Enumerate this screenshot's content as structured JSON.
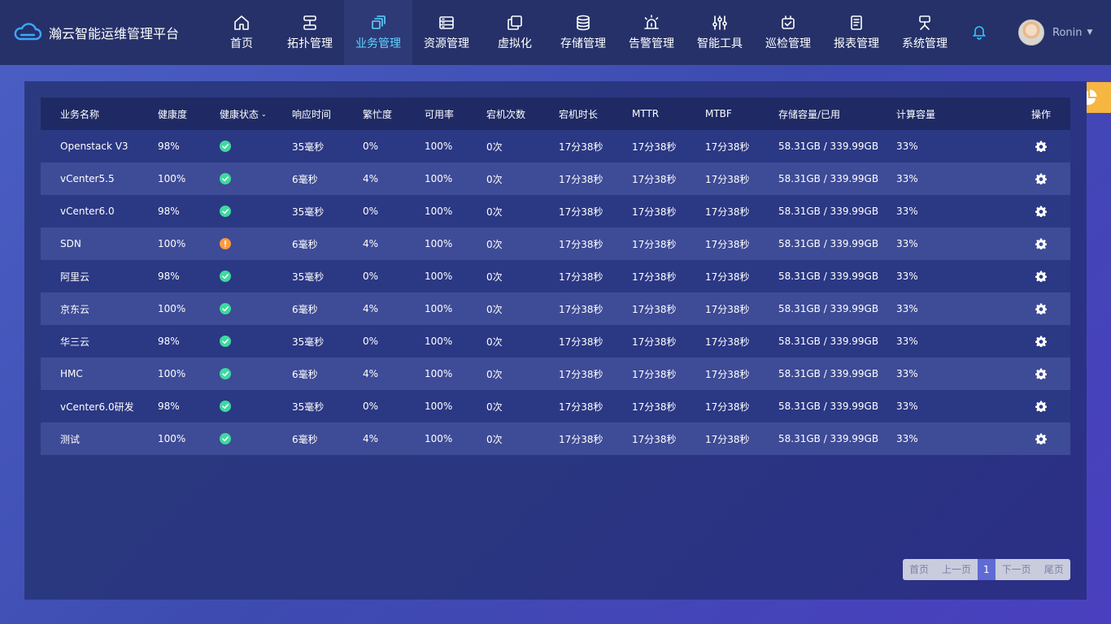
{
  "header": {
    "brand_name": "瀚云智能运维管理平台",
    "nav": [
      {
        "label": "首页",
        "icon": "home-icon",
        "active": false
      },
      {
        "label": "拓扑管理",
        "icon": "topology-icon",
        "active": false
      },
      {
        "label": "业务管理",
        "icon": "business-icon",
        "active": true
      },
      {
        "label": "资源管理",
        "icon": "server-icon",
        "active": false
      },
      {
        "label": "虚拟化",
        "icon": "virtualization-icon",
        "active": false
      },
      {
        "label": "存储管理",
        "icon": "database-icon",
        "active": false
      },
      {
        "label": "告警管理",
        "icon": "alarm-icon",
        "active": false
      },
      {
        "label": "智能工具",
        "icon": "tools-icon",
        "active": false
      },
      {
        "label": "巡检管理",
        "icon": "inspection-icon",
        "active": false
      },
      {
        "label": "报表管理",
        "icon": "report-icon",
        "active": false
      },
      {
        "label": "系统管理",
        "icon": "system-icon",
        "active": false
      }
    ],
    "user_name": "Ronin"
  },
  "table": {
    "columns": [
      "业务名称",
      "健康度",
      "健康状态",
      "响应时间",
      "繁忙度",
      "可用率",
      "宕机次数",
      "宕机时长",
      "MTTR",
      "MTBF",
      "存储容量/已用",
      "计算容量",
      "操作"
    ],
    "rows": [
      {
        "name": "Openstack V3",
        "health": "98%",
        "status": "ok",
        "response": "35毫秒",
        "busy": "0%",
        "avail": "100%",
        "down_count": "0次",
        "down_time": "17分38秒",
        "mttr": "17分38秒",
        "mtbf": "17分38秒",
        "storage": "58.31GB / 339.99GB",
        "compute": "33%"
      },
      {
        "name": "vCenter5.5",
        "health": "100%",
        "status": "ok",
        "response": "6毫秒",
        "busy": "4%",
        "avail": "100%",
        "down_count": "0次",
        "down_time": "17分38秒",
        "mttr": "17分38秒",
        "mtbf": "17分38秒",
        "storage": "58.31GB / 339.99GB",
        "compute": "33%"
      },
      {
        "name": "vCenter6.0",
        "health": "98%",
        "status": "ok",
        "response": "35毫秒",
        "busy": "0%",
        "avail": "100%",
        "down_count": "0次",
        "down_time": "17分38秒",
        "mttr": "17分38秒",
        "mtbf": "17分38秒",
        "storage": "58.31GB / 339.99GB",
        "compute": "33%"
      },
      {
        "name": "SDN",
        "health": "100%",
        "status": "warn",
        "response": "6毫秒",
        "busy": "4%",
        "avail": "100%",
        "down_count": "0次",
        "down_time": "17分38秒",
        "mttr": "17分38秒",
        "mtbf": "17分38秒",
        "storage": "58.31GB / 339.99GB",
        "compute": "33%"
      },
      {
        "name": "阿里云",
        "health": "98%",
        "status": "ok",
        "response": "35毫秒",
        "busy": "0%",
        "avail": "100%",
        "down_count": "0次",
        "down_time": "17分38秒",
        "mttr": "17分38秒",
        "mtbf": "17分38秒",
        "storage": "58.31GB / 339.99GB",
        "compute": "33%"
      },
      {
        "name": "京东云",
        "health": "100%",
        "status": "ok",
        "response": "6毫秒",
        "busy": "4%",
        "avail": "100%",
        "down_count": "0次",
        "down_time": "17分38秒",
        "mttr": "17分38秒",
        "mtbf": "17分38秒",
        "storage": "58.31GB / 339.99GB",
        "compute": "33%"
      },
      {
        "name": "华三云",
        "health": "98%",
        "status": "ok",
        "response": "35毫秒",
        "busy": "0%",
        "avail": "100%",
        "down_count": "0次",
        "down_time": "17分38秒",
        "mttr": "17分38秒",
        "mtbf": "17分38秒",
        "storage": "58.31GB / 339.99GB",
        "compute": "33%"
      },
      {
        "name": "HMC",
        "health": "100%",
        "status": "ok",
        "response": "6毫秒",
        "busy": "4%",
        "avail": "100%",
        "down_count": "0次",
        "down_time": "17分38秒",
        "mttr": "17分38秒",
        "mtbf": "17分38秒",
        "storage": "58.31GB / 339.99GB",
        "compute": "33%"
      },
      {
        "name": "vCenter6.0研发",
        "health": "98%",
        "status": "ok",
        "response": "35毫秒",
        "busy": "0%",
        "avail": "100%",
        "down_count": "0次",
        "down_time": "17分38秒",
        "mttr": "17分38秒",
        "mtbf": "17分38秒",
        "storage": "58.31GB / 339.99GB",
        "compute": "33%"
      },
      {
        "name": "测试",
        "health": "100%",
        "status": "ok",
        "response": "6毫秒",
        "busy": "4%",
        "avail": "100%",
        "down_count": "0次",
        "down_time": "17分38秒",
        "mttr": "17分38秒",
        "mtbf": "17分38秒",
        "storage": "58.31GB / 339.99GB",
        "compute": "33%"
      }
    ]
  },
  "pagination": {
    "first": "首页",
    "prev": "上一页",
    "current": "1",
    "next": "下一页",
    "last": "尾页"
  },
  "colors": {
    "accent": "#5fd4ff",
    "status_ok": "#3ed9a0",
    "status_warn": "#ff9a3c",
    "float_widget": "#f5b642"
  }
}
